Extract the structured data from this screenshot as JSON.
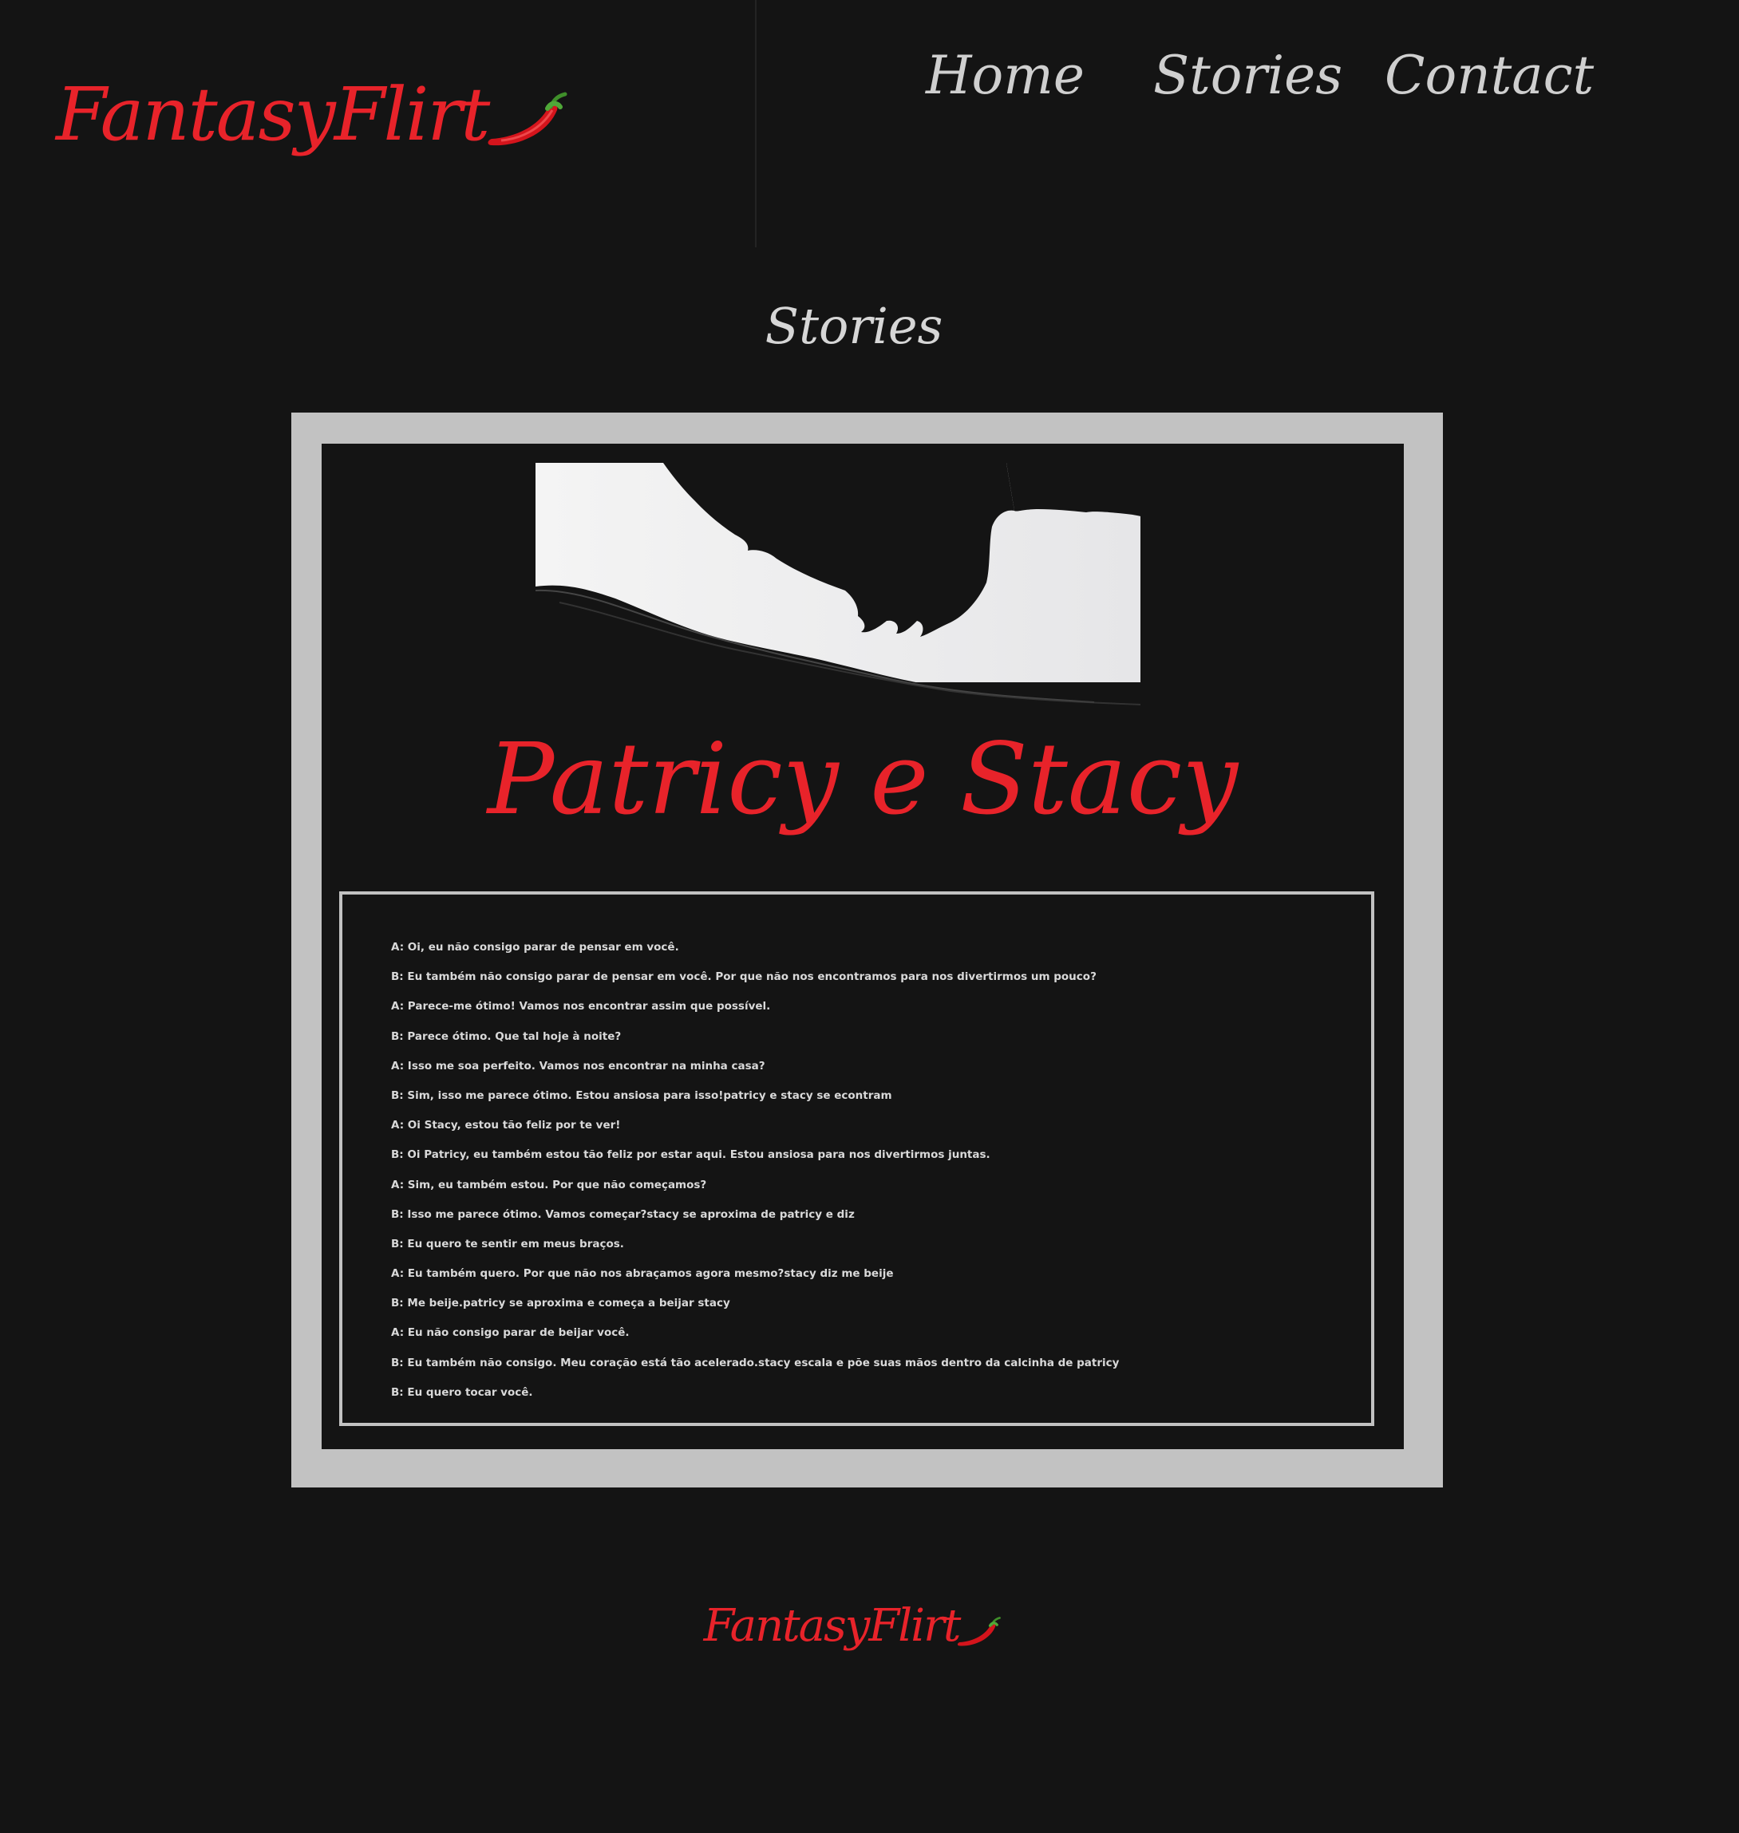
{
  "brand": {
    "name": "FantasyFlirt",
    "accent_color": "#e8232a",
    "pepper_icon": "chili-pepper-icon"
  },
  "nav": {
    "items": [
      {
        "label": "Home"
      },
      {
        "label": "Stories"
      },
      {
        "label": "Contact"
      }
    ]
  },
  "page": {
    "title": "Stories",
    "background": "#141414"
  },
  "story": {
    "image_icon": "kissing-silhouette-image",
    "title": "Patricy e Stacy",
    "frame_color": "#c2c2c2",
    "lines": [
      "A: Oi, eu não consigo parar de pensar em você.",
      "B: Eu também não consigo parar de pensar em você. Por que não nos encontramos para nos divertirmos um pouco?",
      "A: Parece-me ótimo! Vamos nos encontrar assim que possível.",
      "B: Parece ótimo. Que tal hoje à noite?",
      "A: Isso me soa perfeito. Vamos nos encontrar na minha casa?",
      "B: Sim, isso me parece ótimo. Estou ansiosa para isso!patricy e stacy se econtram",
      "A: Oi Stacy, estou tão feliz por te ver!",
      "B: Oi Patricy, eu também estou tão feliz por estar aqui. Estou ansiosa para nos divertirmos juntas.",
      "A: Sim, eu também estou. Por que não começamos?",
      "B: Isso me parece ótimo. Vamos começar?stacy se aproxima de patricy e diz",
      "B: Eu quero te sentir em meus braços.",
      "A: Eu também quero. Por que não nos abraçamos agora mesmo?stacy diz me beije",
      "B: Me beije.patricy se aproxima e começa a beijar stacy",
      "A: Eu não consigo parar de beijar você.",
      "B: Eu também não consigo. Meu coração está tão acelerado.stacy escala e põe suas mãos dentro da calcinha de patricy",
      "B: Eu quero tocar você."
    ]
  },
  "footer": {
    "brand": "FantasyFlirt"
  }
}
